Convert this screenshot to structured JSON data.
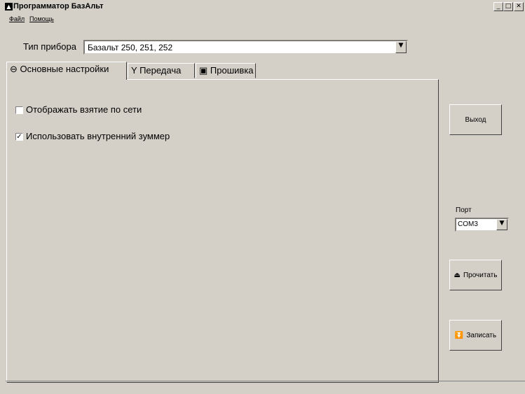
{
  "window": {
    "title": "Программатор БазАльт",
    "app_icon": "app-logo-icon",
    "controls": [
      "minimize-icon",
      "maximize-icon",
      "close-icon"
    ]
  },
  "menu": {
    "items": [
      {
        "label": "Файл"
      },
      {
        "label": "Помощь"
      }
    ]
  },
  "device": {
    "label": "Тип прибора",
    "selected": "Базальт 250, 251, 252"
  },
  "tabs": [
    {
      "label": "Основные настройки",
      "icon": "circle-minus-icon",
      "active": true
    },
    {
      "label": "Передача",
      "icon": "antenna-icon",
      "active": false
    },
    {
      "label": "Прошивка",
      "icon": "chip-icon",
      "active": false
    }
  ],
  "settings": {
    "show_network": {
      "label": "Отображать взятие по сети",
      "checked": false
    },
    "use_buzzer": {
      "label": "Использовать внутренний зуммер",
      "checked": true
    }
  },
  "side": {
    "exit_label": "Выход",
    "port_label": "Порт",
    "port_selected": "COM3",
    "read_label": "Прочитать",
    "read_icon": "eject-icon",
    "write_label": "Записать",
    "write_icon": "download-icon"
  }
}
